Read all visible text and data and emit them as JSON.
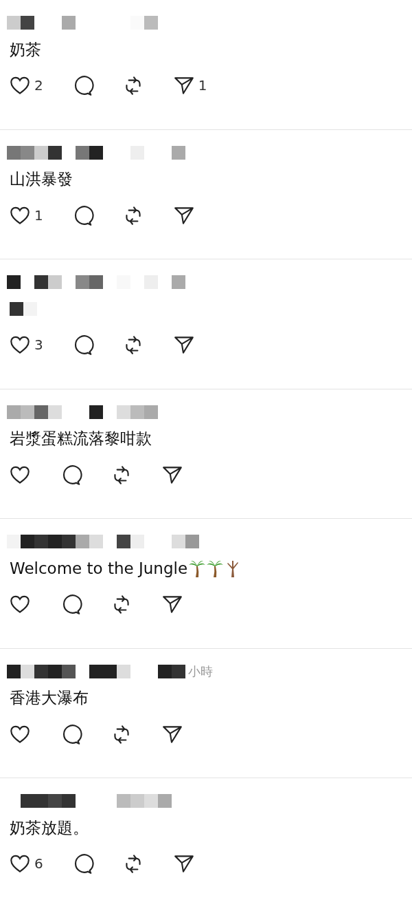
{
  "posts": [
    {
      "kind": "text",
      "text": "奶茶",
      "likes": "2",
      "shares": "1"
    },
    {
      "kind": "text",
      "text": "山洪暴發",
      "likes": "1"
    },
    {
      "kind": "redacted",
      "likes": "3"
    },
    {
      "kind": "text",
      "text": "岩漿蛋糕流落黎咁款"
    },
    {
      "kind": "text",
      "text": "Welcome to the Jungle",
      "emoji": [
        {
          "kind": "palm"
        },
        {
          "kind": "palm"
        },
        {
          "kind": "bare_tree"
        }
      ]
    },
    {
      "kind": "text",
      "text": "香港大瀑布",
      "time": "小時"
    },
    {
      "kind": "text",
      "text": "奶茶放題。",
      "likes": "6"
    }
  ]
}
